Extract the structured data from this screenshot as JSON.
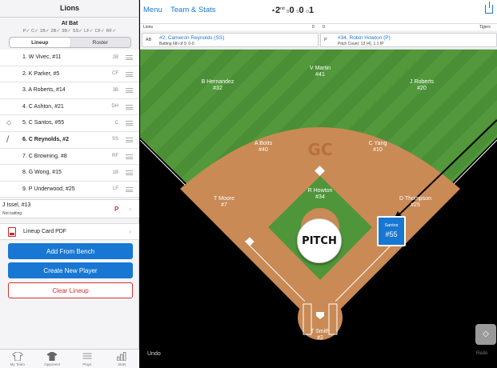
{
  "left_panel": {
    "team_title": "Lions",
    "at_bat_label": "At Bat",
    "positions_strip": "P✓ C✓ 1B✓ 2B✓ 3B✓ SS✓ LF✓ CF✓ RF✓",
    "segmented": {
      "lineup": "Lineup",
      "roster": "Roster"
    },
    "lineup": [
      {
        "name": "1. W Vivec, #11",
        "pos": "2B"
      },
      {
        "name": "2. K Parker, #5",
        "pos": "CF"
      },
      {
        "name": "3. A Roberts, #14",
        "pos": "3B"
      },
      {
        "name": "4. C Ashton, #21",
        "pos": "DH"
      },
      {
        "name": "5. C Santos, #55",
        "pos": "C",
        "icon": "baserunner-icon"
      },
      {
        "name": "6. C Reynolds, #2",
        "pos": "SS",
        "icon": "bat-icon"
      },
      {
        "name": "7. C Browning, #8",
        "pos": "RF"
      },
      {
        "name": "8. G Wong, #15",
        "pos": "1B"
      },
      {
        "name": "9. P Underwood, #25",
        "pos": "LF"
      }
    ],
    "bench": {
      "name": "J Issel, #13",
      "status": "Not batting",
      "pos": "P"
    },
    "pdf_label": "Lineup Card PDF",
    "add_from_bench": "Add From Bench",
    "create_new_player": "Create New Player",
    "clear_lineup": "Clear Lineup",
    "tabs": [
      {
        "label": "My Team",
        "icon": "jersey-icon"
      },
      {
        "label": "Opponent",
        "icon": "jersey-dark-icon"
      },
      {
        "label": "Plays",
        "icon": "list-icon"
      },
      {
        "label": "Stats",
        "icon": "bar-chart-icon"
      }
    ]
  },
  "top_bar": {
    "menu": "Menu",
    "team_stats": "Team & Stats",
    "inning_num": "2",
    "inning_suffix": "nd",
    "balls_label": "B",
    "balls": "0",
    "strikes_label": "S",
    "strikes": "0",
    "outs_label": "O",
    "outs": "1"
  },
  "scoreboard": {
    "home": "Lions",
    "home_score": "0",
    "away_score": "0",
    "away": "Tigers"
  },
  "at_bat_bar": {
    "batter_tag": "AB",
    "batter_name": "#2, Cameron Reynolds (SS)",
    "batter_info": "Batting 6th of 9, 0-0",
    "pitcher_tag": "P",
    "pitcher_name": "#34, Robin Howton (P)",
    "pitcher_info": "Pitch Count: 13 (4), 1.1 IP"
  },
  "field": {
    "logo": "GC",
    "pitch_button": "PITCH",
    "undo": "Undo",
    "redo": "Redo",
    "players": {
      "lf": {
        "name": "B Hernandez",
        "num": "#32"
      },
      "cf": {
        "name": "V Martin",
        "num": "#41"
      },
      "rf": {
        "name": "J Roberts",
        "num": "#20"
      },
      "ss": {
        "name": "A Botts",
        "num": "#40"
      },
      "b2": {
        "name": "C Yang",
        "num": "#10"
      },
      "p": {
        "name": "R Howton",
        "num": "#34"
      },
      "b3": {
        "name": "T Moore",
        "num": "#7"
      },
      "b1": {
        "name": "D Thompson",
        "num": "#25"
      },
      "c": {
        "name": "T Smith",
        "num": "#2"
      }
    },
    "runner": {
      "name": "Santos",
      "num": "#55"
    }
  }
}
